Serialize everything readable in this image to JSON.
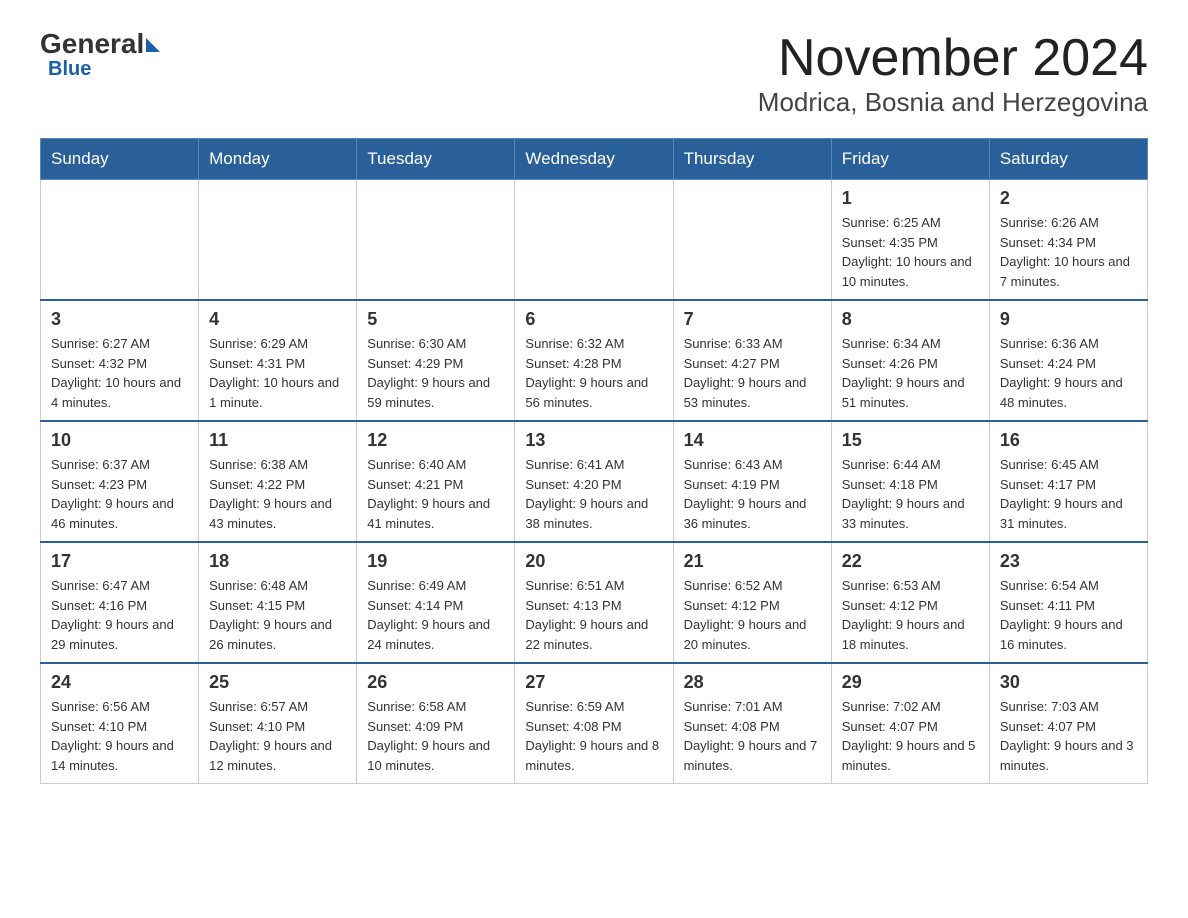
{
  "header": {
    "logo_general": "General",
    "logo_blue": "Blue",
    "month_title": "November 2024",
    "location": "Modrica, Bosnia and Herzegovina"
  },
  "days_of_week": [
    "Sunday",
    "Monday",
    "Tuesday",
    "Wednesday",
    "Thursday",
    "Friday",
    "Saturday"
  ],
  "weeks": [
    [
      {
        "day": "",
        "sunrise": "",
        "sunset": "",
        "daylight": ""
      },
      {
        "day": "",
        "sunrise": "",
        "sunset": "",
        "daylight": ""
      },
      {
        "day": "",
        "sunrise": "",
        "sunset": "",
        "daylight": ""
      },
      {
        "day": "",
        "sunrise": "",
        "sunset": "",
        "daylight": ""
      },
      {
        "day": "",
        "sunrise": "",
        "sunset": "",
        "daylight": ""
      },
      {
        "day": "1",
        "sunrise": "Sunrise: 6:25 AM",
        "sunset": "Sunset: 4:35 PM",
        "daylight": "Daylight: 10 hours and 10 minutes."
      },
      {
        "day": "2",
        "sunrise": "Sunrise: 6:26 AM",
        "sunset": "Sunset: 4:34 PM",
        "daylight": "Daylight: 10 hours and 7 minutes."
      }
    ],
    [
      {
        "day": "3",
        "sunrise": "Sunrise: 6:27 AM",
        "sunset": "Sunset: 4:32 PM",
        "daylight": "Daylight: 10 hours and 4 minutes."
      },
      {
        "day": "4",
        "sunrise": "Sunrise: 6:29 AM",
        "sunset": "Sunset: 4:31 PM",
        "daylight": "Daylight: 10 hours and 1 minute."
      },
      {
        "day": "5",
        "sunrise": "Sunrise: 6:30 AM",
        "sunset": "Sunset: 4:29 PM",
        "daylight": "Daylight: 9 hours and 59 minutes."
      },
      {
        "day": "6",
        "sunrise": "Sunrise: 6:32 AM",
        "sunset": "Sunset: 4:28 PM",
        "daylight": "Daylight: 9 hours and 56 minutes."
      },
      {
        "day": "7",
        "sunrise": "Sunrise: 6:33 AM",
        "sunset": "Sunset: 4:27 PM",
        "daylight": "Daylight: 9 hours and 53 minutes."
      },
      {
        "day": "8",
        "sunrise": "Sunrise: 6:34 AM",
        "sunset": "Sunset: 4:26 PM",
        "daylight": "Daylight: 9 hours and 51 minutes."
      },
      {
        "day": "9",
        "sunrise": "Sunrise: 6:36 AM",
        "sunset": "Sunset: 4:24 PM",
        "daylight": "Daylight: 9 hours and 48 minutes."
      }
    ],
    [
      {
        "day": "10",
        "sunrise": "Sunrise: 6:37 AM",
        "sunset": "Sunset: 4:23 PM",
        "daylight": "Daylight: 9 hours and 46 minutes."
      },
      {
        "day": "11",
        "sunrise": "Sunrise: 6:38 AM",
        "sunset": "Sunset: 4:22 PM",
        "daylight": "Daylight: 9 hours and 43 minutes."
      },
      {
        "day": "12",
        "sunrise": "Sunrise: 6:40 AM",
        "sunset": "Sunset: 4:21 PM",
        "daylight": "Daylight: 9 hours and 41 minutes."
      },
      {
        "day": "13",
        "sunrise": "Sunrise: 6:41 AM",
        "sunset": "Sunset: 4:20 PM",
        "daylight": "Daylight: 9 hours and 38 minutes."
      },
      {
        "day": "14",
        "sunrise": "Sunrise: 6:43 AM",
        "sunset": "Sunset: 4:19 PM",
        "daylight": "Daylight: 9 hours and 36 minutes."
      },
      {
        "day": "15",
        "sunrise": "Sunrise: 6:44 AM",
        "sunset": "Sunset: 4:18 PM",
        "daylight": "Daylight: 9 hours and 33 minutes."
      },
      {
        "day": "16",
        "sunrise": "Sunrise: 6:45 AM",
        "sunset": "Sunset: 4:17 PM",
        "daylight": "Daylight: 9 hours and 31 minutes."
      }
    ],
    [
      {
        "day": "17",
        "sunrise": "Sunrise: 6:47 AM",
        "sunset": "Sunset: 4:16 PM",
        "daylight": "Daylight: 9 hours and 29 minutes."
      },
      {
        "day": "18",
        "sunrise": "Sunrise: 6:48 AM",
        "sunset": "Sunset: 4:15 PM",
        "daylight": "Daylight: 9 hours and 26 minutes."
      },
      {
        "day": "19",
        "sunrise": "Sunrise: 6:49 AM",
        "sunset": "Sunset: 4:14 PM",
        "daylight": "Daylight: 9 hours and 24 minutes."
      },
      {
        "day": "20",
        "sunrise": "Sunrise: 6:51 AM",
        "sunset": "Sunset: 4:13 PM",
        "daylight": "Daylight: 9 hours and 22 minutes."
      },
      {
        "day": "21",
        "sunrise": "Sunrise: 6:52 AM",
        "sunset": "Sunset: 4:12 PM",
        "daylight": "Daylight: 9 hours and 20 minutes."
      },
      {
        "day": "22",
        "sunrise": "Sunrise: 6:53 AM",
        "sunset": "Sunset: 4:12 PM",
        "daylight": "Daylight: 9 hours and 18 minutes."
      },
      {
        "day": "23",
        "sunrise": "Sunrise: 6:54 AM",
        "sunset": "Sunset: 4:11 PM",
        "daylight": "Daylight: 9 hours and 16 minutes."
      }
    ],
    [
      {
        "day": "24",
        "sunrise": "Sunrise: 6:56 AM",
        "sunset": "Sunset: 4:10 PM",
        "daylight": "Daylight: 9 hours and 14 minutes."
      },
      {
        "day": "25",
        "sunrise": "Sunrise: 6:57 AM",
        "sunset": "Sunset: 4:10 PM",
        "daylight": "Daylight: 9 hours and 12 minutes."
      },
      {
        "day": "26",
        "sunrise": "Sunrise: 6:58 AM",
        "sunset": "Sunset: 4:09 PM",
        "daylight": "Daylight: 9 hours and 10 minutes."
      },
      {
        "day": "27",
        "sunrise": "Sunrise: 6:59 AM",
        "sunset": "Sunset: 4:08 PM",
        "daylight": "Daylight: 9 hours and 8 minutes."
      },
      {
        "day": "28",
        "sunrise": "Sunrise: 7:01 AM",
        "sunset": "Sunset: 4:08 PM",
        "daylight": "Daylight: 9 hours and 7 minutes."
      },
      {
        "day": "29",
        "sunrise": "Sunrise: 7:02 AM",
        "sunset": "Sunset: 4:07 PM",
        "daylight": "Daylight: 9 hours and 5 minutes."
      },
      {
        "day": "30",
        "sunrise": "Sunrise: 7:03 AM",
        "sunset": "Sunset: 4:07 PM",
        "daylight": "Daylight: 9 hours and 3 minutes."
      }
    ]
  ]
}
